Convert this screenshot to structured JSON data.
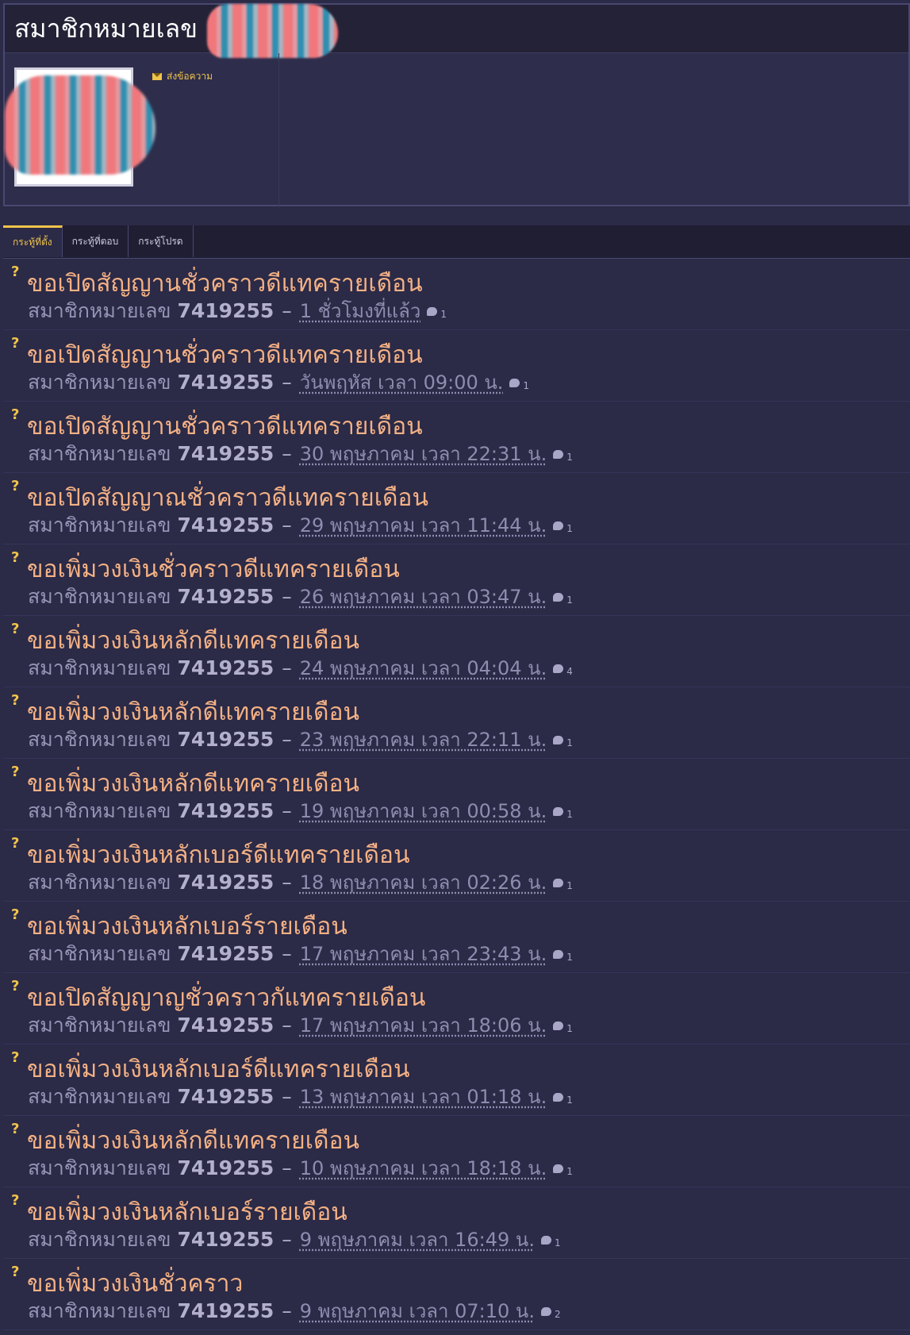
{
  "profile": {
    "title": "สมาชิกหมายเลข",
    "send_message": "ส่งข้อความ"
  },
  "tabs": [
    {
      "label": "กระทู้ที่ตั้ง",
      "active": true
    },
    {
      "label": "กระทู้ที่ตอบ",
      "active": false
    },
    {
      "label": "กระทู้โปรด",
      "active": false
    }
  ],
  "topics": [
    {
      "title": "ขอเปิดสัญญานชั่วคราวดีแทครายเดือน",
      "member_label": "สมาชิกหมายเลข",
      "member_id": "7419255",
      "date": "1 ชั่วโมงที่แล้ว",
      "comments": "1"
    },
    {
      "title": "ขอเปิดสัญญานชั่วคราวดีแทครายเดือน",
      "member_label": "สมาชิกหมายเลข",
      "member_id": "7419255",
      "date": "วันพฤหัส เวลา 09:00 น.",
      "comments": "1"
    },
    {
      "title": "ขอเปิดสัญญานชั่วคราวดีแทครายเดือน",
      "member_label": "สมาชิกหมายเลข",
      "member_id": "7419255",
      "date": "30 พฤษภาคม เวลา 22:31 น.",
      "comments": "1"
    },
    {
      "title": "ขอเปิดสัญญาณชั่วคราวดีแทครายเดือน",
      "member_label": "สมาชิกหมายเลข",
      "member_id": "7419255",
      "date": "29 พฤษภาคม เวลา 11:44 น.",
      "comments": "1"
    },
    {
      "title": "ขอเพิ่มวงเงินชั่วคราวดีแทครายเดือน",
      "member_label": "สมาชิกหมายเลข",
      "member_id": "7419255",
      "date": "26 พฤษภาคม เวลา 03:47 น.",
      "comments": "1"
    },
    {
      "title": "ขอเพิ่มวงเงินหลักดีแทครายเดือน",
      "member_label": "สมาชิกหมายเลข",
      "member_id": "7419255",
      "date": "24 พฤษภาคม เวลา 04:04 น.",
      "comments": "4"
    },
    {
      "title": "ขอเพิ่มวงเงินหลักดีแทครายเดือน",
      "member_label": "สมาชิกหมายเลข",
      "member_id": "7419255",
      "date": "23 พฤษภาคม เวลา 22:11 น.",
      "comments": "1"
    },
    {
      "title": "ขอเพิ่มวงเงินหลักดีแทครายเดือน",
      "member_label": "สมาชิกหมายเลข",
      "member_id": "7419255",
      "date": "19 พฤษภาคม เวลา 00:58 น.",
      "comments": "1"
    },
    {
      "title": "ขอเพิ่มวงเงินหลักเบอร์ดีแทครายเดือน",
      "member_label": "สมาชิกหมายเลข",
      "member_id": "7419255",
      "date": "18 พฤษภาคม เวลา 02:26 น.",
      "comments": "1"
    },
    {
      "title": "ขอเพิ่มวงเงินหลักเบอร์รายเดือน",
      "member_label": "สมาชิกหมายเลข",
      "member_id": "7419255",
      "date": "17 พฤษภาคม เวลา 23:43 น.",
      "comments": "1"
    },
    {
      "title": "ขอเปิดสัญญาญชั่วคราวกัแทครายเดือน",
      "member_label": "สมาชิกหมายเลข",
      "member_id": "7419255",
      "date": "17 พฤษภาคม เวลา 18:06 น.",
      "comments": "1"
    },
    {
      "title": "ขอเพิ่มวงเงินหลักเบอร์ดีแทครายเดือน",
      "member_label": "สมาชิกหมายเลข",
      "member_id": "7419255",
      "date": "13 พฤษภาคม เวลา 01:18 น.",
      "comments": "1"
    },
    {
      "title": "ขอเพิ่มวงเงินหลักดีแทครายเดือน",
      "member_label": "สมาชิกหมายเลข",
      "member_id": "7419255",
      "date": "10 พฤษภาคม เวลา 18:18 น.",
      "comments": "1"
    },
    {
      "title": "ขอเพิ่มวงเงินหลักเบอร์รายเดือน",
      "member_label": "สมาชิกหมายเลข",
      "member_id": "7419255",
      "date": "9 พฤษภาคม เวลา 16:49 น.",
      "comments": "1"
    },
    {
      "title": "ขอเพิ่มวงเงินชั่วคราว",
      "member_label": "สมาชิกหมายเลข",
      "member_id": "7419255",
      "date": "9 พฤษภาคม เวลา 07:10 น.",
      "comments": "2"
    }
  ],
  "colors": {
    "background": "#2b2a47",
    "title_bar": "#232236",
    "topic_title": "#f4b184",
    "accent": "#f0c44a",
    "meta_text": "#9794b6"
  },
  "icons": {
    "question": "question-mark-icon",
    "comment": "comment-bubble-icon",
    "mail": "mail-icon"
  }
}
